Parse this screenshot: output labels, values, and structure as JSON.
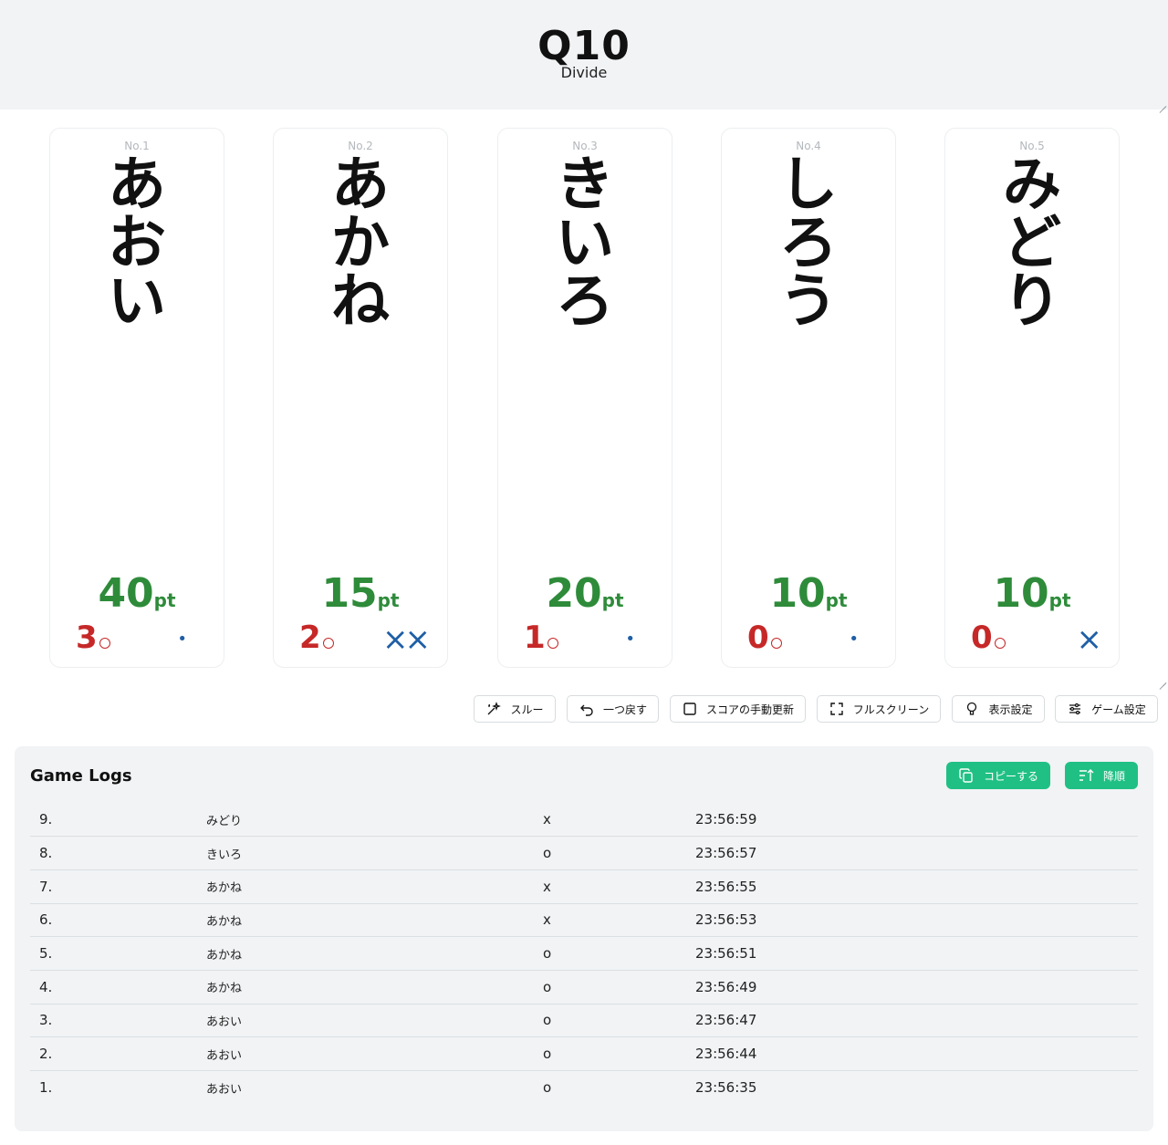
{
  "header": {
    "title": "Q10",
    "subtitle": "Divide"
  },
  "players": [
    {
      "num": "No.1",
      "name": [
        "あ",
        "お",
        "い"
      ],
      "points": "40",
      "unit": "pt",
      "correct": "3",
      "wrong": "•",
      "wrong_count": 0
    },
    {
      "num": "No.2",
      "name": [
        "あ",
        "か",
        "ね"
      ],
      "points": "15",
      "unit": "pt",
      "correct": "2",
      "wrong": "××",
      "wrong_count": 2
    },
    {
      "num": "No.3",
      "name": [
        "き",
        "い",
        "ろ"
      ],
      "points": "20",
      "unit": "pt",
      "correct": "1",
      "wrong": "•",
      "wrong_count": 0
    },
    {
      "num": "No.4",
      "name": [
        "し",
        "ろ",
        "う"
      ],
      "points": "10",
      "unit": "pt",
      "correct": "0",
      "wrong": "•",
      "wrong_count": 0
    },
    {
      "num": "No.5",
      "name": [
        "み",
        "ど",
        "り"
      ],
      "points": "10",
      "unit": "pt",
      "correct": "0",
      "wrong": "×",
      "wrong_count": 1
    }
  ],
  "toolbar": {
    "through": "スルー",
    "undo": "一つ戻す",
    "manual_update": "スコアの手動更新",
    "fullscreen": "フルスクリーン",
    "display_settings": "表示設定",
    "game_settings": "ゲーム設定"
  },
  "logs": {
    "title": "Game Logs",
    "copy_label": "コピーする",
    "sort_label": "降順",
    "rows": [
      {
        "idx": "9.",
        "name": "みどり",
        "result": "x",
        "time": "23:56:59"
      },
      {
        "idx": "8.",
        "name": "きいろ",
        "result": "o",
        "time": "23:56:57"
      },
      {
        "idx": "7.",
        "name": "あかね",
        "result": "x",
        "time": "23:56:55"
      },
      {
        "idx": "6.",
        "name": "あかね",
        "result": "x",
        "time": "23:56:53"
      },
      {
        "idx": "5.",
        "name": "あかね",
        "result": "o",
        "time": "23:56:51"
      },
      {
        "idx": "4.",
        "name": "あかね",
        "result": "o",
        "time": "23:56:49"
      },
      {
        "idx": "3.",
        "name": "あおい",
        "result": "o",
        "time": "23:56:47"
      },
      {
        "idx": "2.",
        "name": "あおい",
        "result": "o",
        "time": "23:56:44"
      },
      {
        "idx": "1.",
        "name": "あおい",
        "result": "o",
        "time": "23:56:35"
      }
    ]
  },
  "colors": {
    "points": "#2e8b3a",
    "correct": "#c62828",
    "wrong": "#1f5fa6",
    "accent_button": "#20c084",
    "header_bg": "#f1f3f5"
  }
}
